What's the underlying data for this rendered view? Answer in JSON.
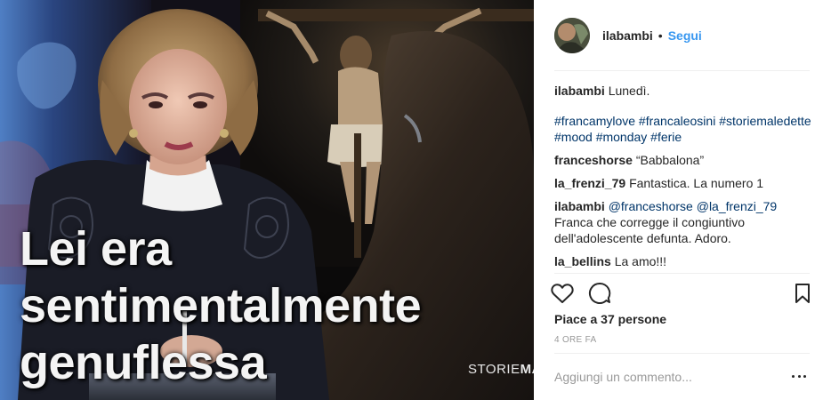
{
  "post": {
    "overlay_lines": [
      "Lei era",
      "sentimentalmente",
      "genuflessa"
    ],
    "watermark_light": "STORIE",
    "watermark_bold": "MALE"
  },
  "header": {
    "username": "ilabambi",
    "separator": "•",
    "follow_label": "Segui"
  },
  "comments": [
    {
      "user": "ilabambi",
      "text": "Lunedì."
    },
    {
      "hashtags": "#francamylove #francaleosini #storiemaledette #mood #monday #ferie"
    },
    {
      "user": "franceshorse",
      "text": "“Babbalona”"
    },
    {
      "user": "la_frenzi_79",
      "text": "Fantastica. La numero 1"
    },
    {
      "user": "ilabambi",
      "mention1": "@franceshorse",
      "mention2": "@la_frenzi_79",
      "text": "Franca che corregge il congiuntivo dell'adolescente defunta. Adoro."
    },
    {
      "user": "la_bellins",
      "text": "La amo!!!"
    }
  ],
  "actions": {
    "like_icon": "heart-outline-icon",
    "comment_icon": "speech-bubble-icon",
    "save_icon": "bookmark-icon"
  },
  "likes_text": "Piace a 37 persone",
  "time_text": "4 ORE FA",
  "add_comment": {
    "placeholder": "Aggiungi un commento..."
  },
  "colors": {
    "link": "#003569",
    "follow": "#3897f0",
    "muted": "#999999",
    "divider": "#efefef"
  }
}
